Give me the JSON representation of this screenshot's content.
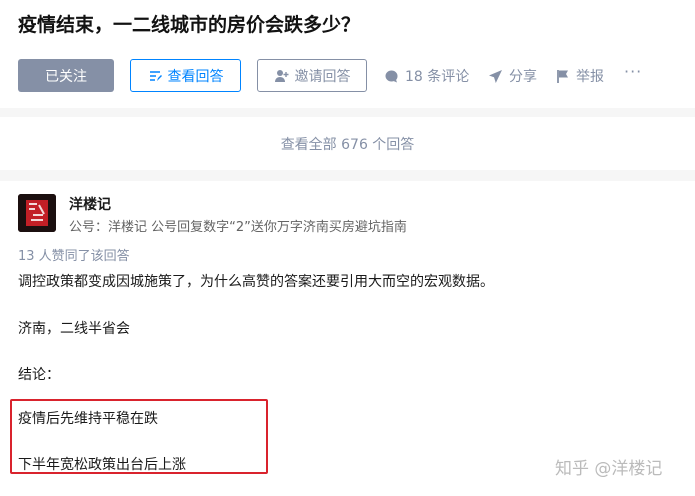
{
  "question": {
    "title": "疫情结束，一二线城市的房价会跌多少？"
  },
  "actions": {
    "followed_label": "已关注",
    "view_answer_label": "查看回答",
    "invite_label": "邀请回答",
    "comments_label": "18 条评论",
    "share_label": "分享",
    "report_label": "举报",
    "more_label": "···"
  },
  "all_answers_label": "查看全部 676 个回答",
  "answer": {
    "author_name": "洋楼记",
    "author_bio": "公号：洋楼记 公号回复数字“2”送你万字济南买房避坑指南",
    "avatar_text": "洋楼记",
    "votes_text": "13 人赞同了该回答",
    "paragraphs": [
      "调控政策都变成因城施策了，为什么高赞的答案还要引用大而空的宏观数据。",
      "济南，二线半省会",
      "结论：",
      "疫情后先维持平稳在跌",
      "下半年宽松政策出台后上涨"
    ]
  },
  "watermark": "知乎 @洋楼记",
  "colors": {
    "accent_blue": "#0084ff",
    "muted_gray": "#8590a6",
    "highlight_red": "#d9232d"
  }
}
